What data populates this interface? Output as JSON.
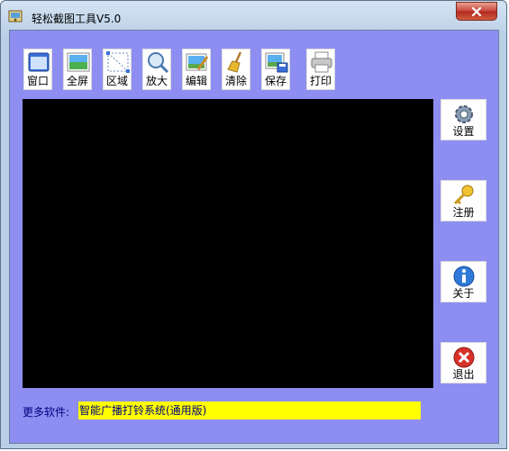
{
  "window": {
    "title": "轻松截图工具V5.0"
  },
  "toolbar": {
    "buttons": [
      {
        "label": "窗口",
        "icon": "window-icon"
      },
      {
        "label": "全屏",
        "icon": "fullscreen-icon"
      },
      {
        "label": "区域",
        "icon": "region-icon"
      },
      {
        "label": "放大",
        "icon": "magnifier-icon"
      },
      {
        "label": "编辑",
        "icon": "edit-image-icon"
      },
      {
        "label": "清除",
        "icon": "broom-icon"
      },
      {
        "label": "保存",
        "icon": "save-image-icon"
      },
      {
        "label": "打印",
        "icon": "printer-icon"
      }
    ]
  },
  "sidebar": {
    "buttons": [
      {
        "label": "设置",
        "icon": "gear-icon"
      },
      {
        "label": "注册",
        "icon": "key-icon"
      },
      {
        "label": "关于",
        "icon": "info-icon"
      },
      {
        "label": "退出",
        "icon": "exit-icon"
      }
    ]
  },
  "footer": {
    "more_label": "更多软件:",
    "more_value": "智能广播打铃系统(通用版)"
  },
  "colors": {
    "client_bg": "#8e8ef2",
    "canvas_bg": "#000000",
    "more_field_bg": "#ffff00",
    "more_text": "#000080"
  }
}
